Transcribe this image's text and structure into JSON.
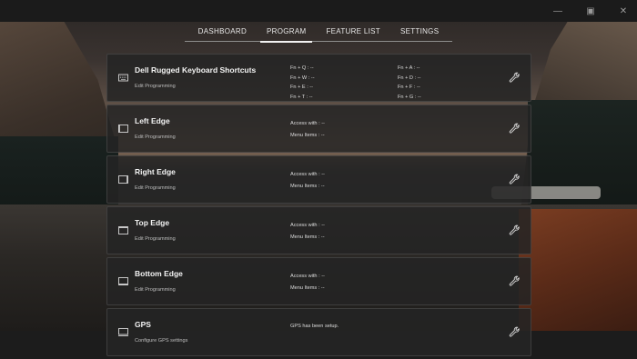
{
  "window": {
    "controls": [
      "—",
      "▣",
      "✕"
    ]
  },
  "nav": {
    "tabs": [
      {
        "label": "DASHBOARD",
        "active": false
      },
      {
        "label": "PROGRAM",
        "active": true
      },
      {
        "label": "FEATURE LIST",
        "active": false
      },
      {
        "label": "SETTINGS",
        "active": false
      }
    ]
  },
  "cards": [
    {
      "icon": "keyboard-icon",
      "title": "Dell Rugged Keyboard Shortcuts",
      "subtitle": "Edit Programming",
      "col1": [
        "Fn + Q : --",
        "Fn + W : --",
        "Fn + E : --",
        "Fn + T : --"
      ],
      "col2": [
        "Fn + A : --",
        "Fn + D : --",
        "Fn + F : --",
        "Fn + G : --"
      ]
    },
    {
      "icon": "edge-left-icon",
      "title": "Left Edge",
      "subtitle": "Edit Programming",
      "col1": [
        "Access with : --",
        "Menu Items : --"
      ]
    },
    {
      "icon": "edge-right-icon",
      "title": "Right Edge",
      "subtitle": "Edit Programming",
      "col1": [
        "Access with : --",
        "Menu Items : --"
      ]
    },
    {
      "icon": "edge-top-icon",
      "title": "Top Edge",
      "subtitle": "Edit Programming",
      "col1": [
        "Access with : --",
        "Menu Items : --"
      ]
    },
    {
      "icon": "edge-bottom-icon",
      "title": "Bottom Edge",
      "subtitle": "Edit Programming",
      "col1": [
        "Access with : --",
        "Menu Items : --"
      ]
    },
    {
      "icon": "gps-icon",
      "title": "GPS",
      "subtitle": "Configure GPS settings",
      "col1": [
        "GPS has been setup."
      ]
    }
  ]
}
